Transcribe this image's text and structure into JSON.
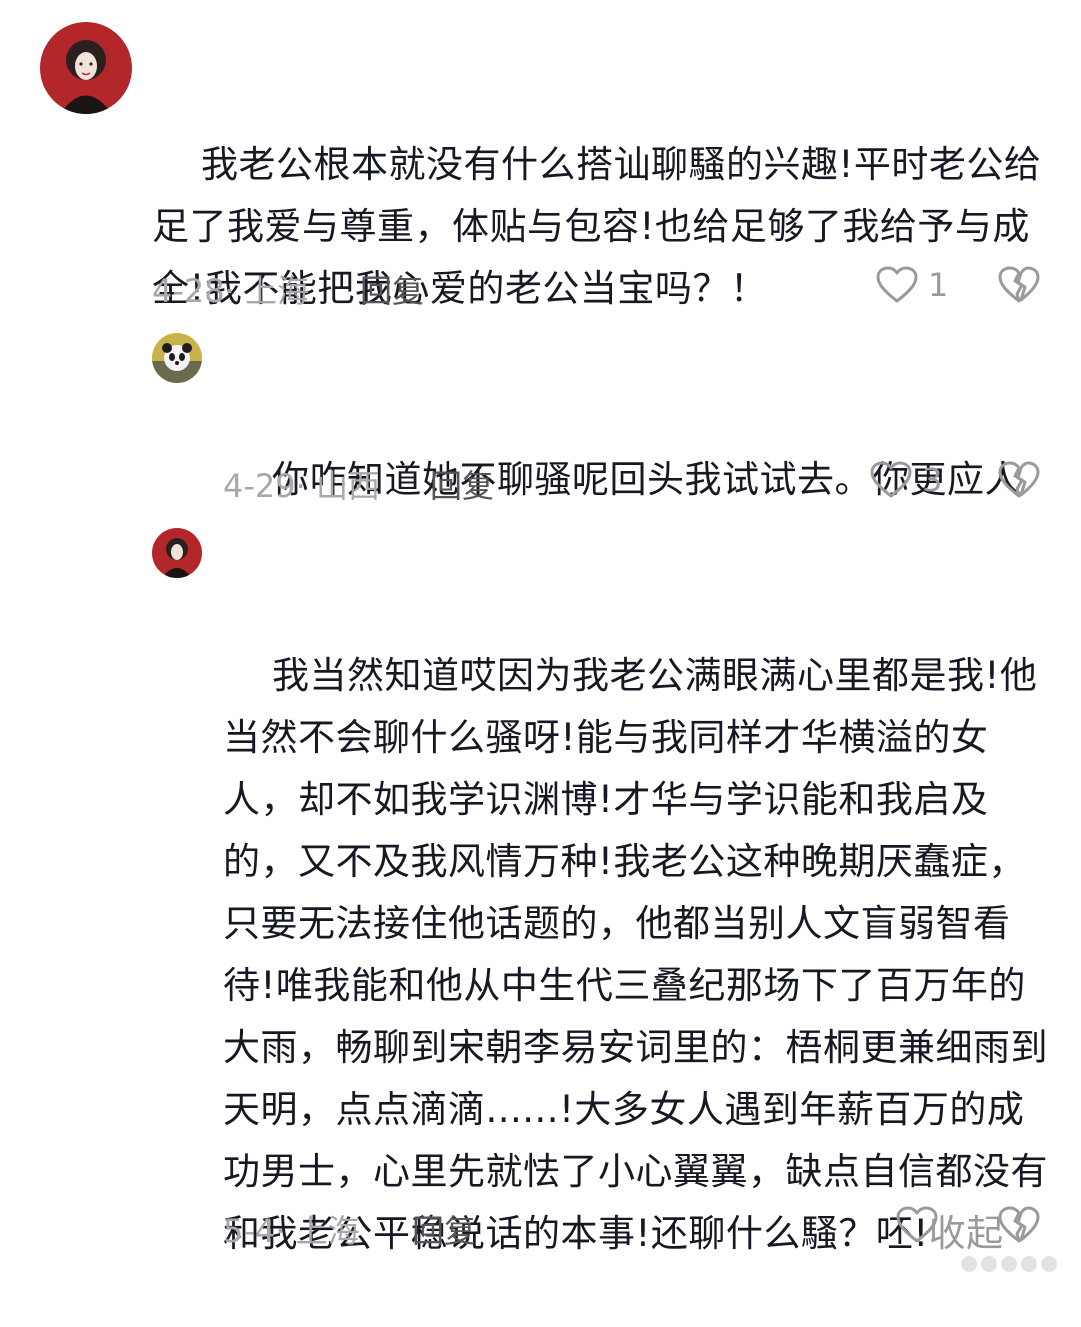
{
  "comments": [
    {
      "text": "我老公根本就没有什么搭讪聊騷的兴趣!平时老公给足了我爱与尊重，体贴与包容!也给足够了我给予与成全!我不能把我心爱的老公当宝吗？！",
      "date": "4-28",
      "location": "上海",
      "reply_label": "回复",
      "like_count": "1",
      "avatar_icon": "user-avatar-red"
    },
    {
      "text": "你咋知道她不聊骚呢回头我试试去。你更应人",
      "date": "4-29",
      "location": "山西",
      "reply_label": "回复",
      "like_count": "3",
      "avatar_icon": "user-avatar-panda"
    },
    {
      "text": "我当然知道哎因为我老公满眼满心里都是我!他当然不会聊什么骚呀!能与我同样才华横溢的女人，却不如我学识渊博!才华与学识能和我启及的，又不及我风情万种!我老公这种晚期厌蠢症，只要无法接住他话题的，他都当别人文盲弱智看待!唯我能和他从中生代三叠纪那场下了百万年的大雨，畅聊到宋朝李易安词里的：梧桐更兼细雨到天明，点点滴滴......!大多女人遇到年薪百万的成功男士，心里先就怯了小心翼翼，缺点自信都没有和我老公平稳说话的本事!还聊什么騷？呸!",
      "collapse_label": "收起",
      "date": "5-4",
      "location": "上海",
      "reply_label": "回复",
      "like_count": "",
      "avatar_icon": "user-avatar-red"
    }
  ],
  "colors": {
    "text": "#161823",
    "meta": "#a8a8a8",
    "reply": "#555555",
    "icon": "#9a9a9a"
  }
}
